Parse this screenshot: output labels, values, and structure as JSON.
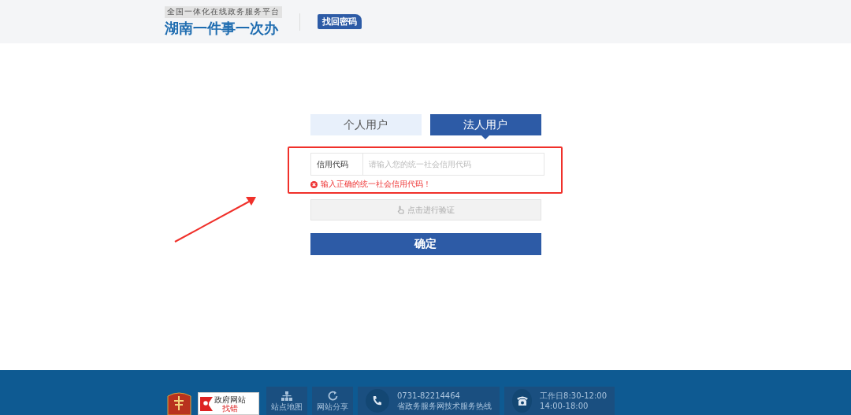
{
  "header": {
    "platform_tagline": "全国一体化在线政务服务平台",
    "site_name": "湖南一件事一次办",
    "page_badge": "找回密码"
  },
  "tabs": [
    {
      "label": "个人用户",
      "selected": false
    },
    {
      "label": "法人用户",
      "selected": true
    }
  ],
  "form": {
    "field_label": "信用代码",
    "placeholder": "请输入您的统一社会信用代码",
    "error": "输入正确的统一社会信用代码！",
    "verify_button": "点击进行验证",
    "submit_button": "确定"
  },
  "footer": {
    "error_badge": {
      "title": "政府网站",
      "action": "找错"
    },
    "links": [
      {
        "label": "站点地图",
        "kind": "sitemap"
      },
      {
        "label": "网站分享",
        "kind": "share"
      }
    ],
    "contacts": [
      {
        "kind": "hotline",
        "line1": "0731-82214464",
        "line2": "省政务服务网技术服务热线"
      },
      {
        "kind": "hours",
        "line1": "工作日8:30-12:00",
        "line2": "14:00-18:00"
      }
    ]
  }
}
